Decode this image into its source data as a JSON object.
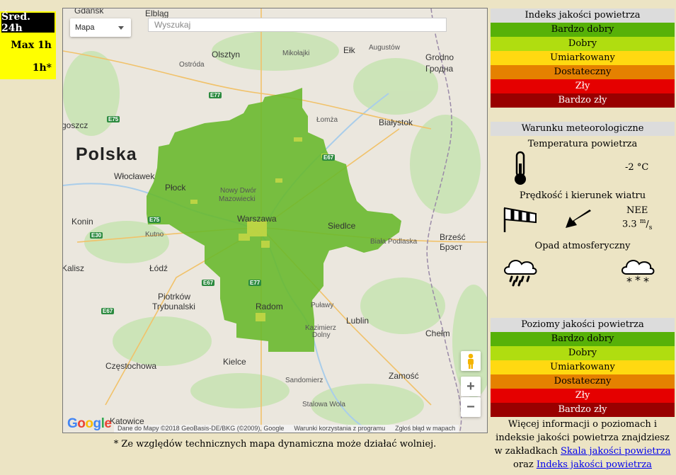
{
  "tabs": [
    {
      "label": "Śred. 24h",
      "active": true
    },
    {
      "label": "Max 1h",
      "active": false
    },
    {
      "label": "1h*",
      "active": false
    }
  ],
  "map": {
    "type_select": "Mapa",
    "search_placeholder": "Wyszukaj",
    "country_label": "Polska",
    "cities": {
      "gdansk": "Gdańsk",
      "elblag": "Elbląg",
      "olsztyn": "Olsztyn",
      "ostroda": "Ostróda",
      "mikolajki": "Mikołajki",
      "elk": "Ełk",
      "augustow": "Augustów",
      "grodno": "Grodno",
      "grodno_cyr": "Гродна",
      "bydgoszcz": "goszcz",
      "lomza": "Łomża",
      "bialystok": "Białystok",
      "wloclawek": "Włocławek",
      "plock": "Płock",
      "nowy_dwor": "Nowy Dwór",
      "mazowiecki": "Mazowiecki",
      "warszawa": "Warszawa",
      "siedlce": "Siedlce",
      "konin": "Konin",
      "kutno": "Kutno",
      "biala": "Biała Podlaska",
      "brzesc": "Brześć",
      "brest_cyr": "Брэст",
      "kalisz": "Kalisz",
      "lodz": "Łódź",
      "piotrkow": "Piotrków",
      "trybunalski": "Trybunalski",
      "radom": "Radom",
      "pulawy": "Puławy",
      "kazimierz": "Kazimierz",
      "dolny": "Dolny",
      "lublin": "Lublin",
      "chelm": "Chełm",
      "czestochowa": "Częstochowa",
      "kielce": "Kielce",
      "sandomierz": "Sandomierz",
      "zamosc": "Zamość",
      "stalowa": "Stalowa Wola",
      "katowice": "Katowice"
    },
    "roads": {
      "e77a": "E77",
      "e75": "E75",
      "e67a": "E67",
      "e75b": "E75",
      "e30": "E30",
      "e67b": "E67",
      "e77b": "E77",
      "e67c": "E67"
    },
    "google_logo": "Google",
    "attribution": {
      "data": "Dane do Mapy ©2018 GeoBasis-DE/BKG (©2009), Google",
      "terms": "Warunki korzystania z programu",
      "report": "Zgłoś błąd w mapach"
    },
    "zoom_in": "+",
    "zoom_out": "−",
    "overlay_color": "#66b82a"
  },
  "note": "* Ze względów technicznych mapa dynamiczna może działać wolniej.",
  "index_panel": {
    "title": "Indeks jakości powietrza",
    "levels": [
      {
        "label": "Bardzo dobry",
        "color": "#57b108"
      },
      {
        "label": "Dobry",
        "color": "#b0dd10"
      },
      {
        "label": "Umiarkowany",
        "color": "#ffd911"
      },
      {
        "label": "Dostateczny",
        "color": "#e58100"
      },
      {
        "label": "Zły",
        "color": "#e50000"
      },
      {
        "label": "Bardzo zły",
        "color": "#990000"
      }
    ]
  },
  "meteo": {
    "title": "Warunku meteorologiczne",
    "temp_title": "Temperatura powietrza",
    "temp_value": "-2",
    "temp_unit": "°C",
    "wind_title": "Prędkość i kierunek wiatru",
    "wind_dir": "NEE",
    "wind_speed": "3.3",
    "wind_unit_num": "m",
    "wind_unit_den": "s",
    "precip_title": "Opad atmosferyczny",
    "icons": [
      "thermometer-icon",
      "windsock-icon",
      "wind-arrow-icon",
      "rain-cloud-icon",
      "snow-cloud-icon"
    ]
  },
  "levels_panel": {
    "title": "Poziomy jakości powietrza",
    "levels": [
      {
        "label": "Bardzo dobry",
        "color": "#57b108"
      },
      {
        "label": "Dobry",
        "color": "#b0dd10"
      },
      {
        "label": "Umiarkowany",
        "color": "#ffd911"
      },
      {
        "label": "Dostateczny",
        "color": "#e58100"
      },
      {
        "label": "Zły",
        "color": "#e50000"
      },
      {
        "label": "Bardzo zły",
        "color": "#990000"
      }
    ]
  },
  "more_info": {
    "line1": "Więcej informacji o poziomach i",
    "line2": "indeksie jakości powietrza znajdziesz",
    "line3_prefix": "w zakładkach",
    "link1": "Skala jakości powietrza",
    "line4_prefix": "oraz",
    "link2": "Indeks jakości powietrza"
  }
}
